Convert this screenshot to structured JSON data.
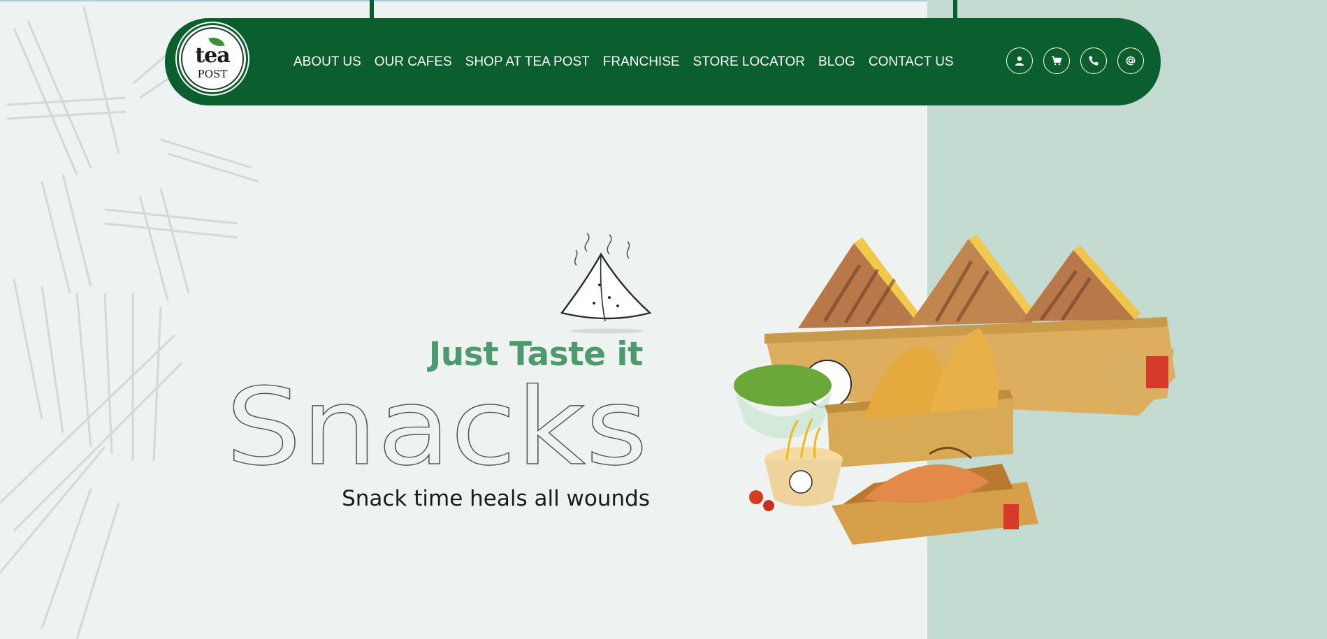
{
  "brand": {
    "logo_line1": "tea",
    "logo_line2": "POST"
  },
  "nav": {
    "links": [
      "ABOUT US",
      "OUR CAFES",
      "SHOP AT TEA POST",
      "FRANCHISE",
      "STORE LOCATOR",
      "BLOG",
      "CONTACT US"
    ],
    "icons": [
      "user-icon",
      "cart-icon",
      "phone-icon",
      "at-icon"
    ]
  },
  "hero": {
    "tagline": "Just Taste it",
    "headline": "Snacks",
    "subline": "Snack time heals all wounds"
  },
  "colors": {
    "brand_green": "#0b5e2e",
    "accent_green": "#4d9a6d",
    "left_bg": "#eef2f0",
    "right_bg": "#c3dbd0"
  }
}
